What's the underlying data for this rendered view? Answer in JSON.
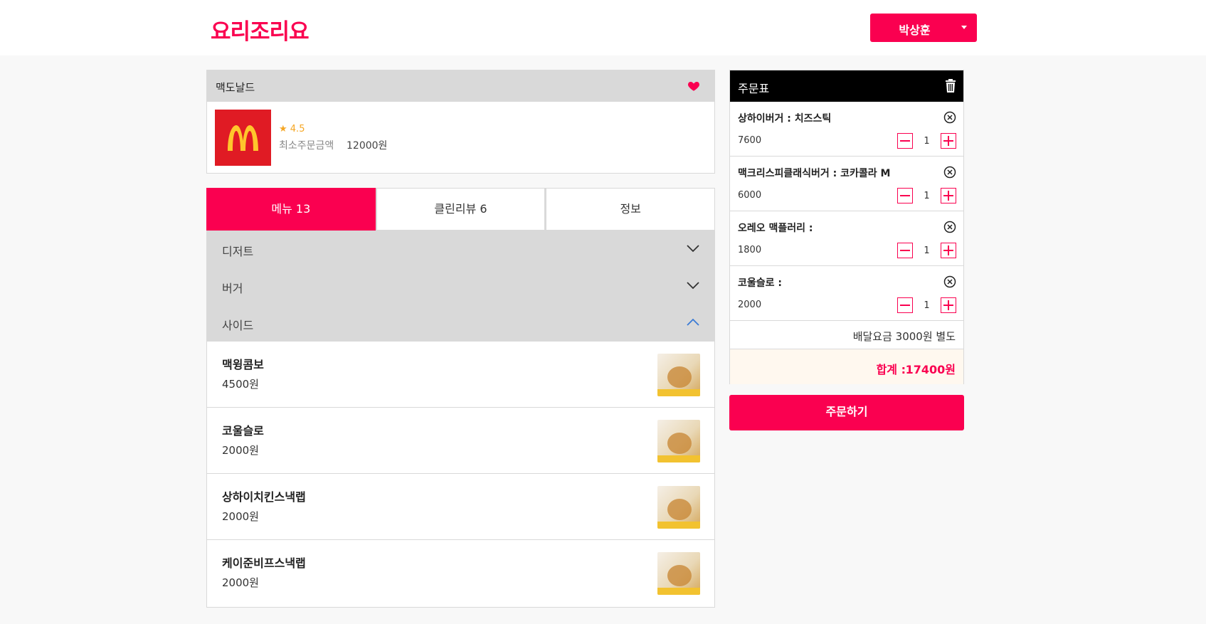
{
  "header": {
    "logo": "요리조리요",
    "user_name": "박상훈"
  },
  "restaurant": {
    "name": "맥도날드",
    "rating": "★ 4.5",
    "min_order_label": "최소주문금액",
    "min_order_value": "12000원"
  },
  "tabs": [
    {
      "label": "메뉴 13"
    },
    {
      "label": "클린리뷰 6"
    },
    {
      "label": "정보"
    }
  ],
  "categories": [
    {
      "label": "디저트"
    },
    {
      "label": "버거"
    },
    {
      "label": "사이드"
    }
  ],
  "menu_items": [
    {
      "name": "맥윙콤보",
      "price": "4500원"
    },
    {
      "name": "코울슬로",
      "price": "2000원"
    },
    {
      "name": "상하이치킨스낵랩",
      "price": "2000원"
    },
    {
      "name": "케이준비프스낵랩",
      "price": "2000원"
    }
  ],
  "cart": {
    "title": "주문표",
    "items": [
      {
        "name": "상하이버거 : 치즈스틱",
        "price": "7600",
        "qty": "1"
      },
      {
        "name": "맥크리스피클래식버거 : 코카콜라 M",
        "price": "6000",
        "qty": "1"
      },
      {
        "name": "오레오 맥플러리 :",
        "price": "1800",
        "qty": "1"
      },
      {
        "name": "코울슬로 :",
        "price": "2000",
        "qty": "1"
      }
    ],
    "delivery_fee": "배달요금 3000원 별도",
    "total_label": "합계 :",
    "total_value": "17400원"
  },
  "order_button": "주문하기",
  "colors": {
    "accent": "#fa0050",
    "panel_gray": "#d9d9d9",
    "total_bg": "#fff8ef"
  }
}
